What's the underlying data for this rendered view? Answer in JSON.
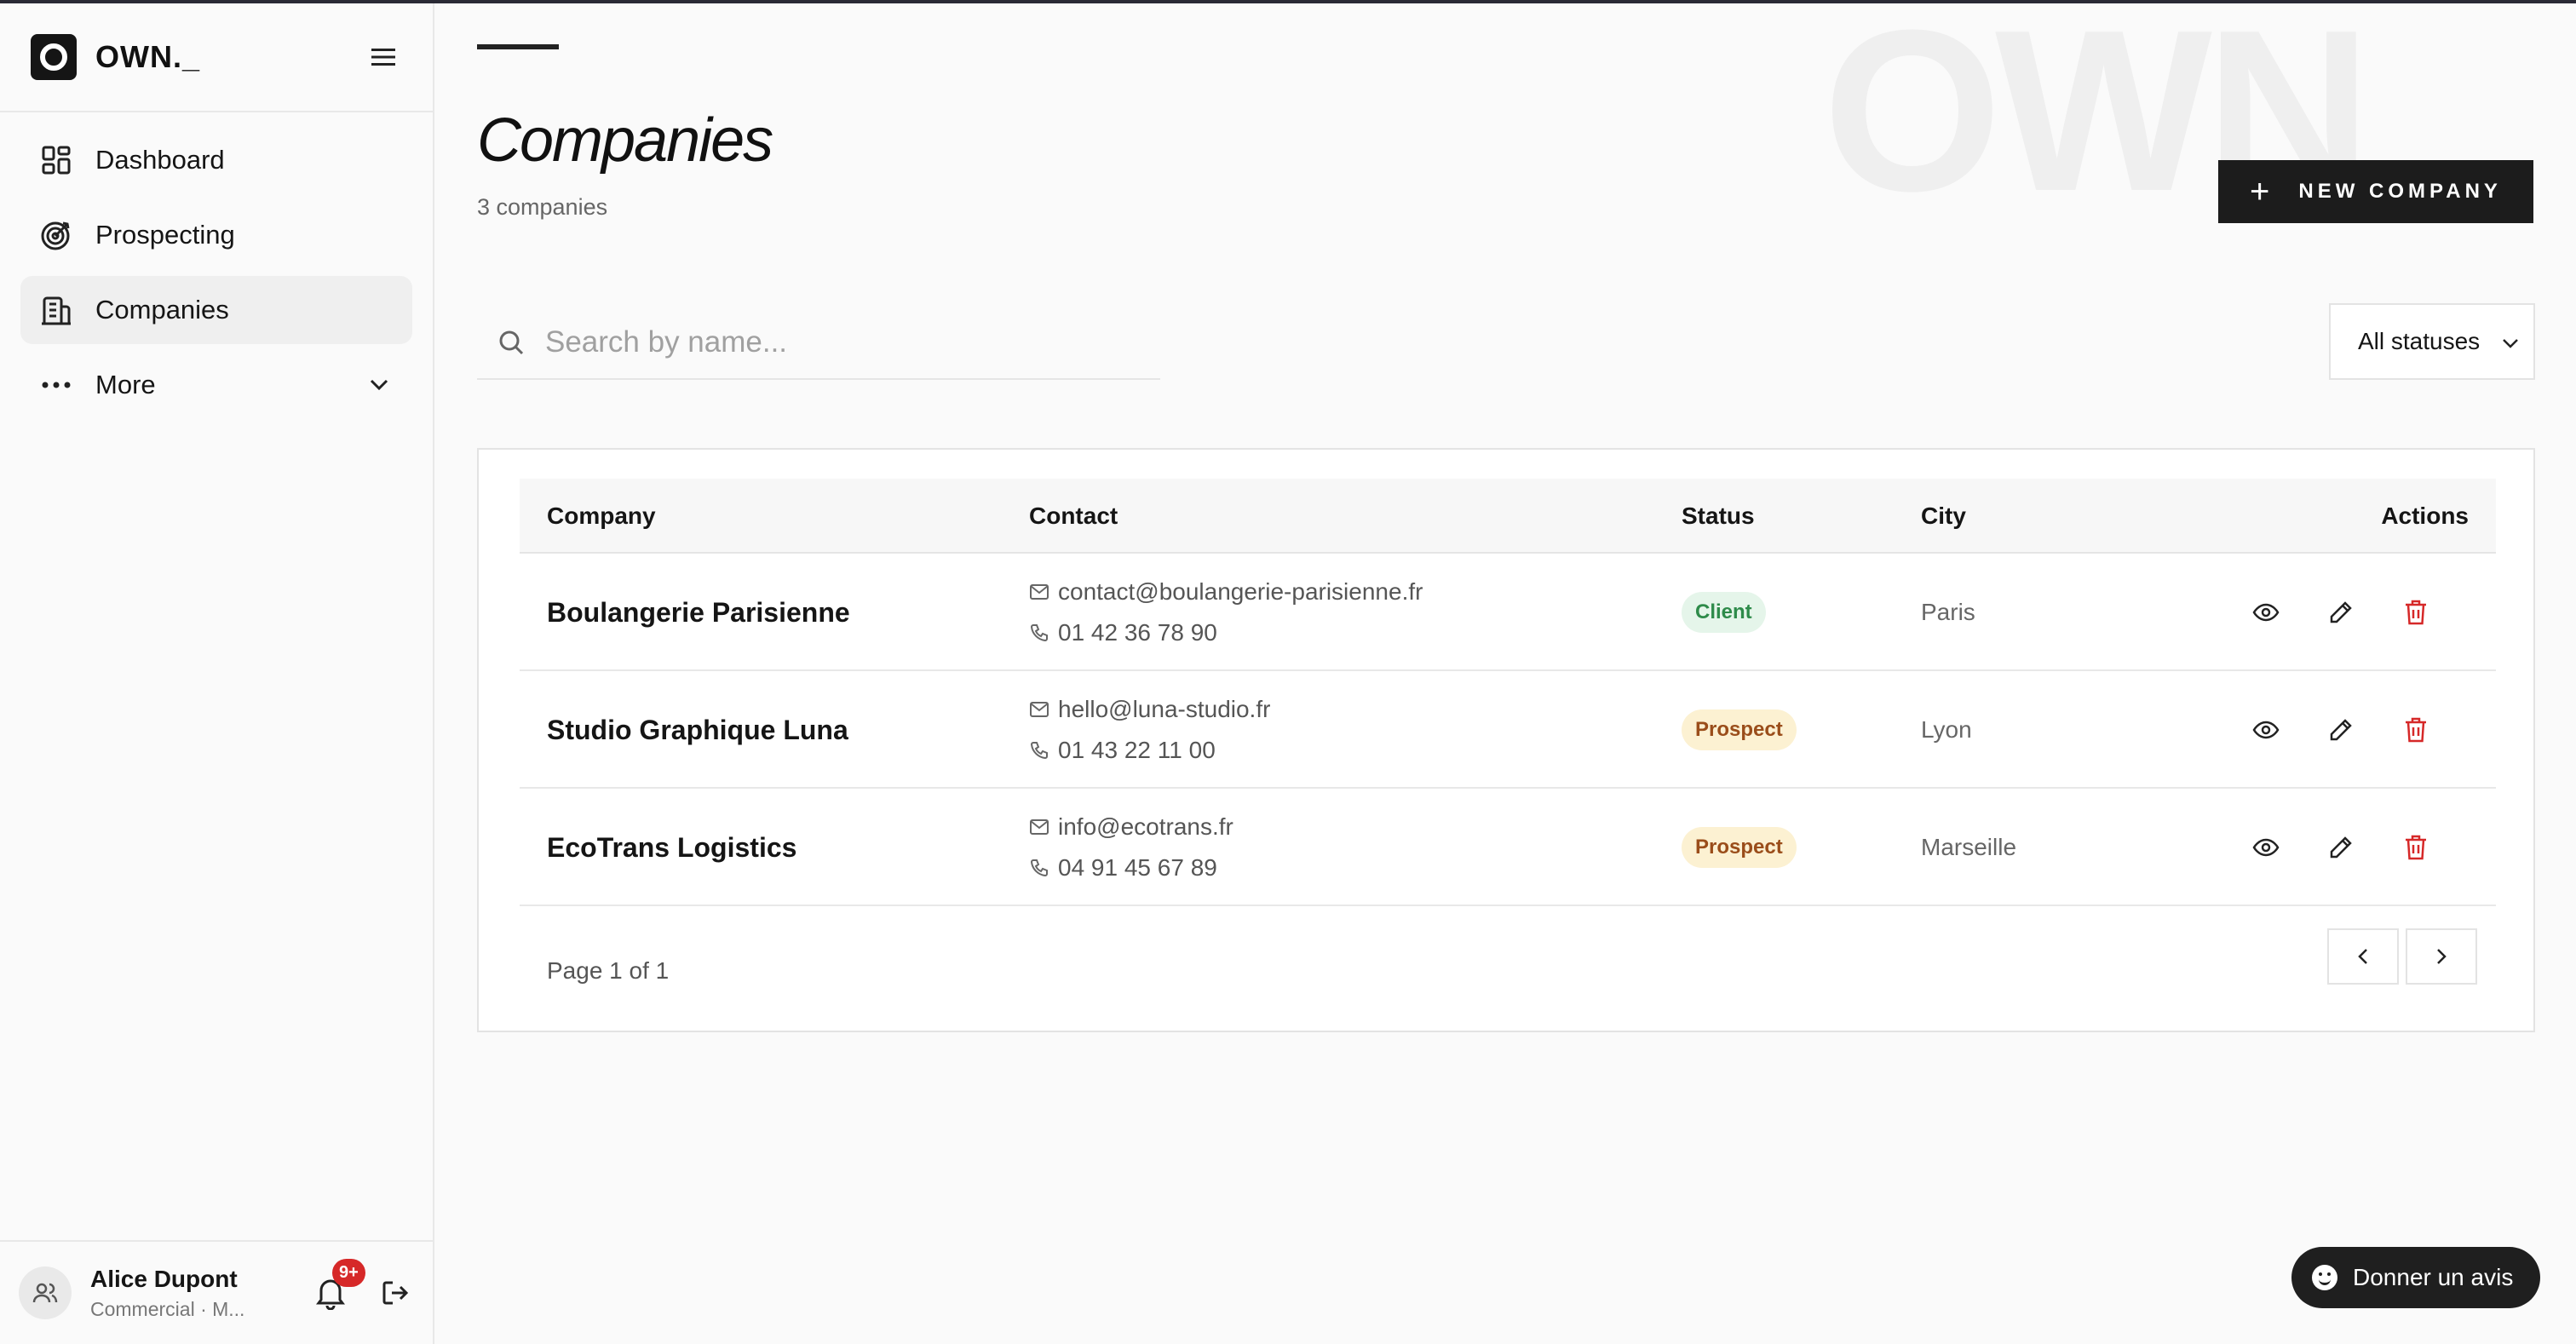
{
  "brand": {
    "name": "OWN._"
  },
  "sidebar": {
    "items": [
      {
        "label": "Dashboard",
        "icon": "grid-icon"
      },
      {
        "label": "Prospecting",
        "icon": "target-icon"
      },
      {
        "label": "Companies",
        "icon": "building-icon",
        "active": true
      },
      {
        "label": "More",
        "icon": "dots-icon"
      }
    ]
  },
  "user": {
    "name": "Alice Dupont",
    "role": "Commercial · M...",
    "notification_badge": "9+"
  },
  "page": {
    "watermark": "OWN",
    "title": "Companies",
    "subtitle": "3 companies",
    "new_button_label": "NEW COMPANY",
    "new_button_plus": "+"
  },
  "search": {
    "placeholder": "Search by name...",
    "value": ""
  },
  "filter": {
    "selected": "All statuses"
  },
  "table": {
    "headers": {
      "company": "Company",
      "contact": "Contact",
      "status": "Status",
      "city": "City",
      "actions": "Actions"
    },
    "rows": [
      {
        "company": "Boulangerie Parisienne",
        "email": "contact@boulangerie-parisienne.fr",
        "phone": "01 42 36 78 90",
        "status": "Client",
        "city": "Paris"
      },
      {
        "company": "Studio Graphique Luna",
        "email": "hello@luna-studio.fr",
        "phone": "01 43 22 11 00",
        "status": "Prospect",
        "city": "Lyon"
      },
      {
        "company": "EcoTrans Logistics",
        "email": "info@ecotrans.fr",
        "phone": "04 91 45 67 89",
        "status": "Prospect",
        "city": "Marseille"
      }
    ],
    "pagination": "Page 1 of 1"
  },
  "feedback": {
    "label": "Donner un avis"
  },
  "colors": {
    "accent_dark": "#1c1c1c",
    "delete_red": "#d62828",
    "client_green": "#2e8b4a",
    "prospect_orange": "#9a4d1a"
  }
}
